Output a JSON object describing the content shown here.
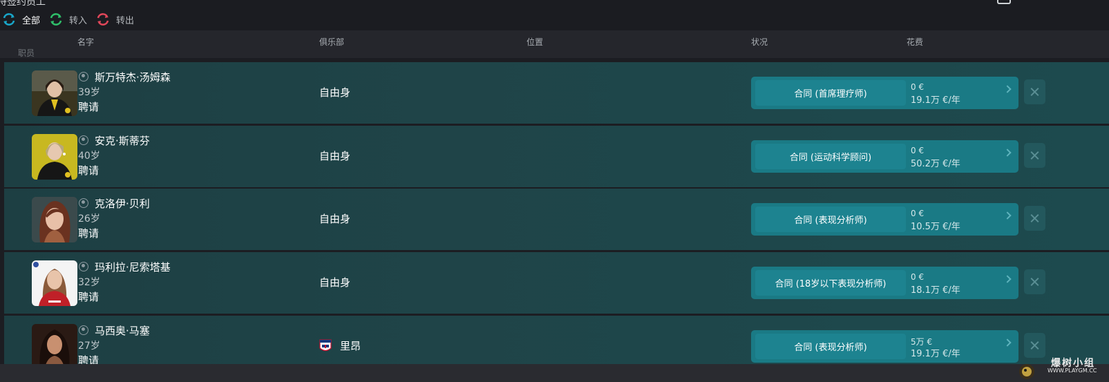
{
  "app": {
    "title": "待签约员工"
  },
  "filters": [
    {
      "label": "全部",
      "icon": "swap-icon",
      "active": true
    },
    {
      "label": "转入",
      "icon": "transfer-in-icon",
      "active": false
    },
    {
      "label": "转出",
      "icon": "transfer-out-icon",
      "active": false
    }
  ],
  "columns": {
    "name": "名字",
    "club": "俱乐部",
    "position": "位置",
    "status": "状况",
    "fee": "花费",
    "sub_label": "职员"
  },
  "rows": [
    {
      "name": "斯万特杰·汤姆森",
      "age": "39岁",
      "status": "聘请",
      "club": "自由身",
      "contract": "合同 (首席理疗师)",
      "fee": "0 €",
      "wage": "19.1万 €/年"
    },
    {
      "name": "安克·斯蒂芬",
      "age": "40岁",
      "status": "聘请",
      "club": "自由身",
      "contract": "合同 (运动科学顾问)",
      "fee": "0 €",
      "wage": "50.2万 €/年"
    },
    {
      "name": "克洛伊·贝利",
      "age": "26岁",
      "status": "聘请",
      "club": "自由身",
      "contract": "合同 (表现分析师)",
      "fee": "0 €",
      "wage": "10.5万 €/年"
    },
    {
      "name": "玛利拉·尼索塔基",
      "age": "32岁",
      "status": "聘请",
      "club": "自由身",
      "contract": "合同 (18岁以下表现分析师)",
      "fee": "0 €",
      "wage": "18.1万 €/年"
    },
    {
      "name": "马西奥·马塞",
      "age": "27岁",
      "status": "聘请",
      "club": "里昂",
      "contract": "合同 (表现分析师)",
      "fee": "5万 €",
      "wage": "19.1万 €/年"
    }
  ],
  "watermark": {
    "text": "爆树小组",
    "url": "WWW.PLAYGM.CC"
  },
  "colors": {
    "row_bg": "#1f4448",
    "contract_bg": "#1a7a85",
    "accent": "#1d8390"
  }
}
